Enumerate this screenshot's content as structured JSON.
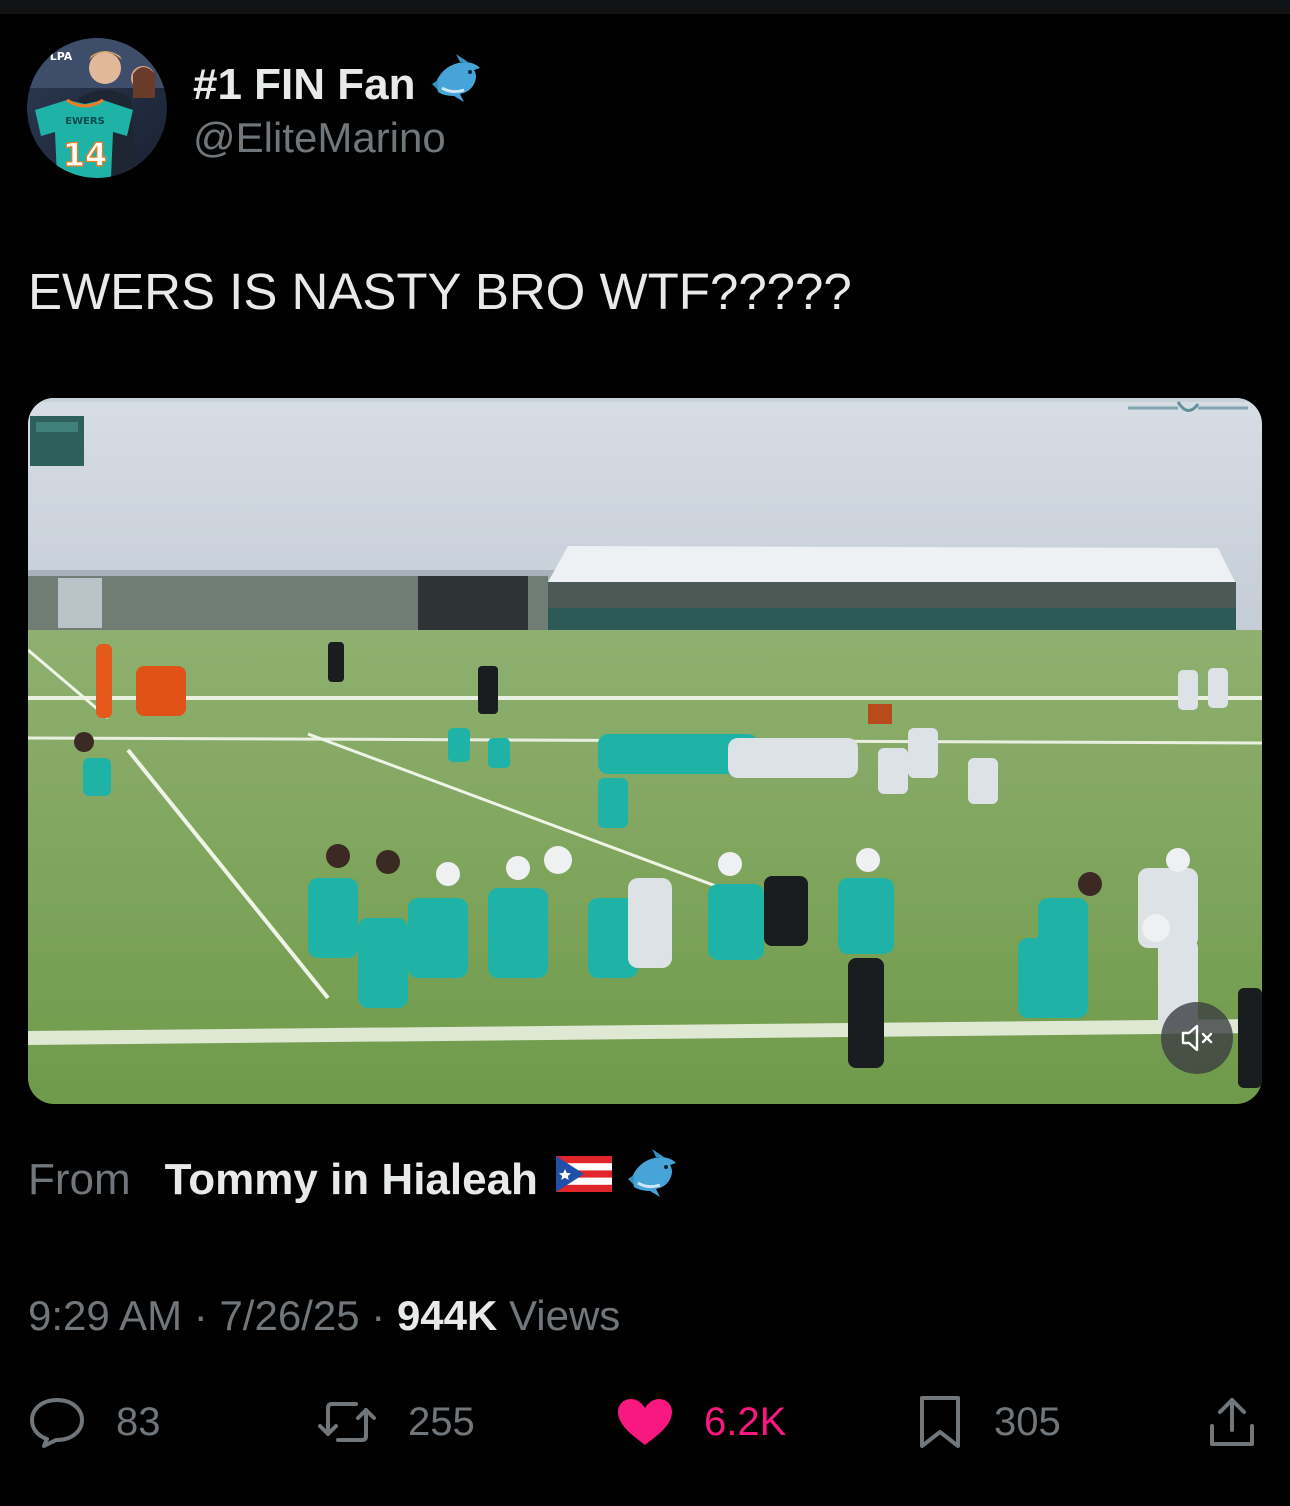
{
  "tweet": {
    "display_name": "#1 FIN Fan",
    "handle": "@EliteMarino",
    "text": "EWERS IS NASTY BRO WTF?????",
    "source_label": "From",
    "source_name": "Tommy in Hialeah",
    "time": "9:29 AM",
    "date": "7/26/25",
    "sep": "·",
    "views_count": "944K",
    "views_label": "Views"
  },
  "actions": {
    "replies": "83",
    "reposts": "255",
    "likes": "6.2K",
    "bookmarks": "305"
  },
  "avatar": {
    "jersey_name": "EWERS",
    "jersey_number": "14",
    "badge": "NFLPA"
  },
  "colors": {
    "background": "#000000",
    "text_primary": "#e7e9ea",
    "text_secondary": "#71767b",
    "like_pink": "#f91880",
    "dolphins_aqua": "#1fb3a8"
  },
  "icons": {
    "dolphin": "dolphin-emoji",
    "flag": "puerto-rico-flag",
    "mute": "speaker-muted-icon",
    "reply": "reply-icon",
    "repost": "repost-icon",
    "like": "heart-icon",
    "bookmark": "bookmark-icon",
    "share": "share-icon"
  }
}
